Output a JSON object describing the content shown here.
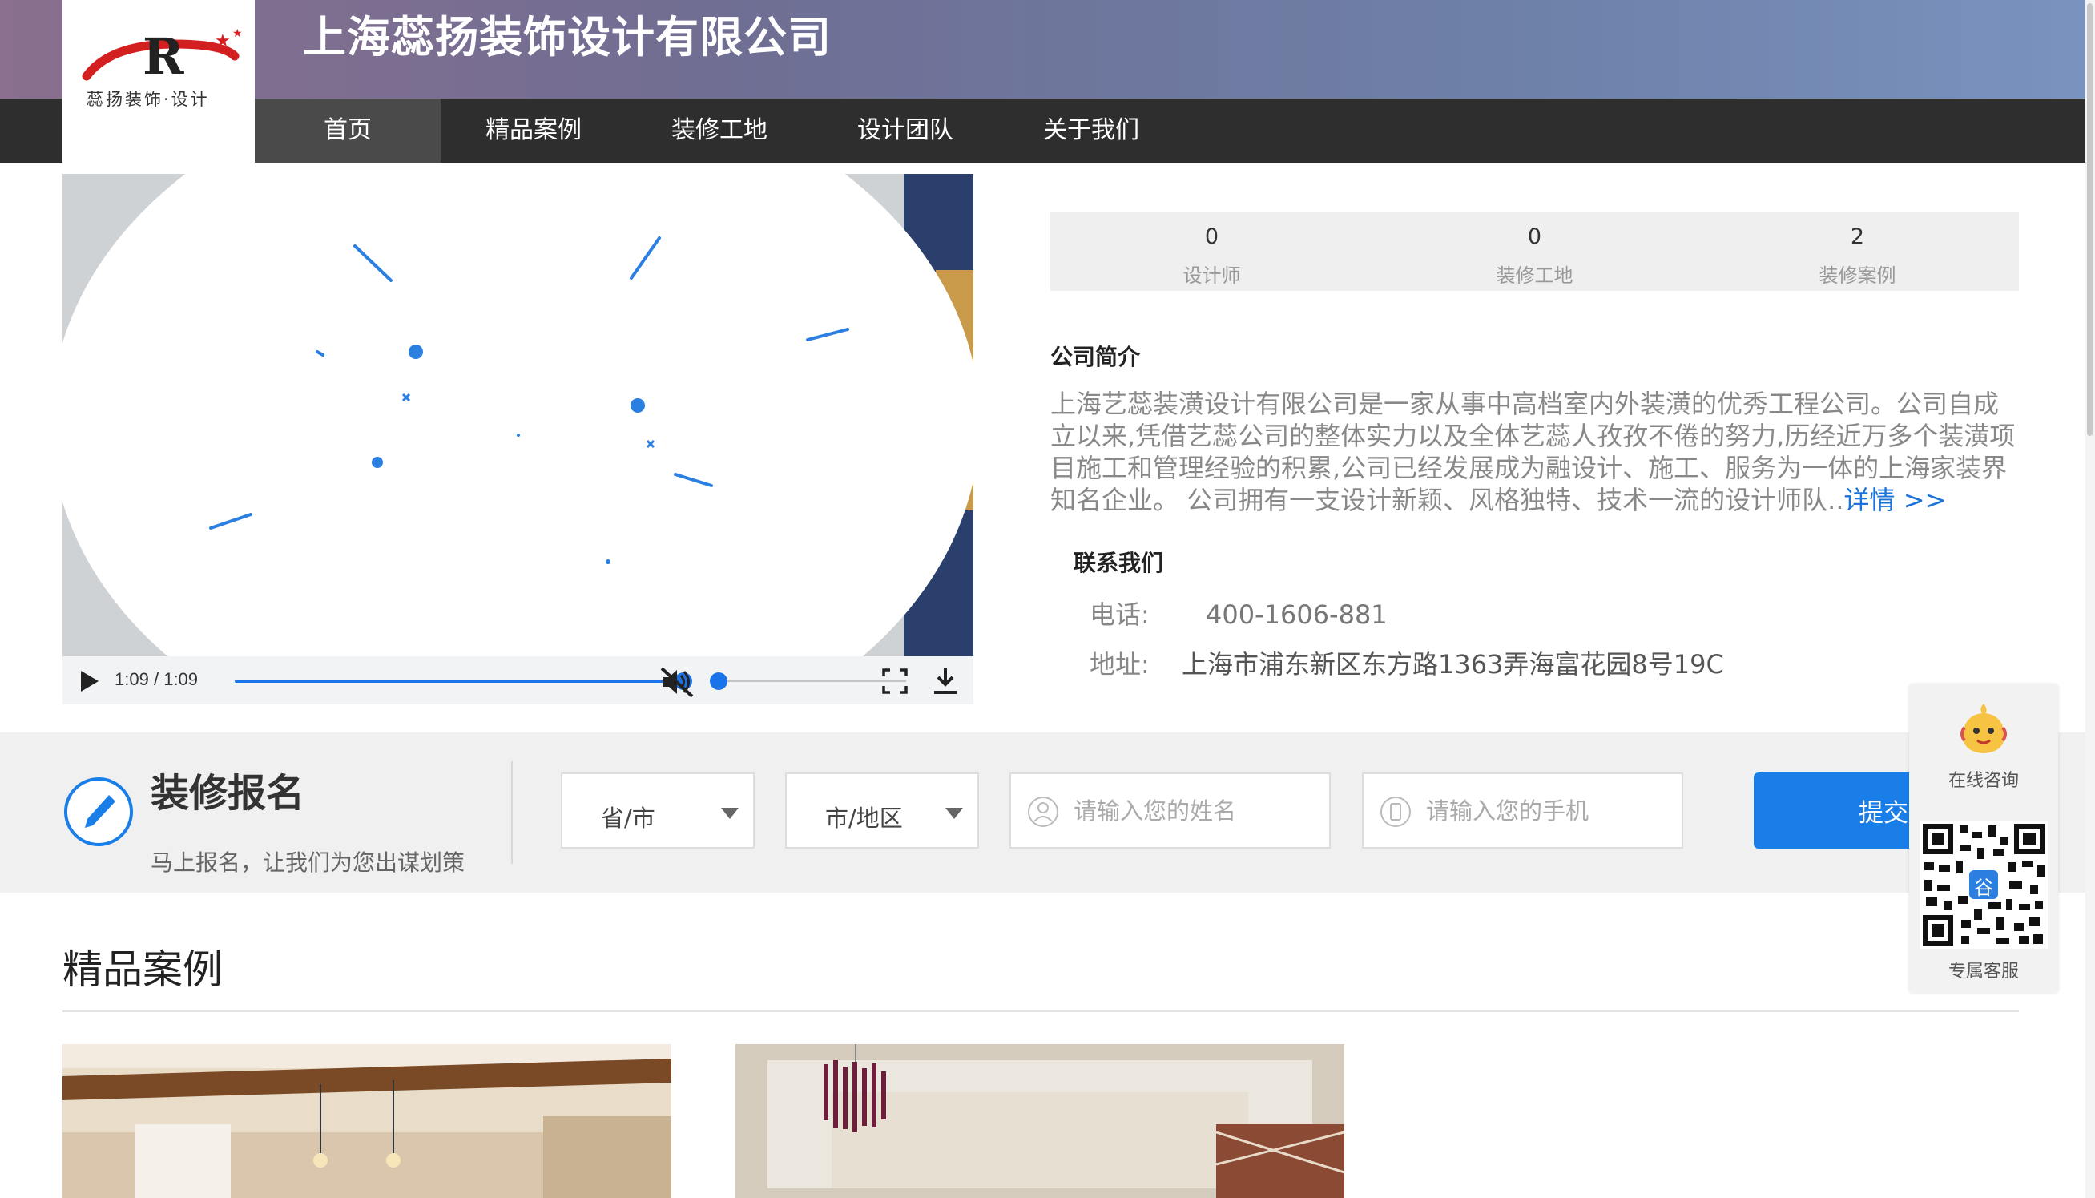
{
  "header": {
    "company_name": "上海蕊扬装饰设计有限公司",
    "logo_text": "蕊扬装饰·设计",
    "nav": [
      {
        "label": "首页",
        "active": true
      },
      {
        "label": "精品案例",
        "active": false
      },
      {
        "label": "装修工地",
        "active": false
      },
      {
        "label": "设计团队",
        "active": false
      },
      {
        "label": "关于我们",
        "active": false
      }
    ]
  },
  "video": {
    "current_time": "1:09",
    "separator": "/",
    "duration": "1:09",
    "progress": 1.0,
    "volume": 0.0
  },
  "stats": [
    {
      "value": "0",
      "label": "设计师"
    },
    {
      "value": "0",
      "label": "装修工地"
    },
    {
      "value": "2",
      "label": "装修案例"
    }
  ],
  "intro": {
    "heading": "公司简介",
    "body": "上海艺蕊装潢设计有限公司是一家从事中高档室内外装潢的优秀工程公司。公司自成立以来,凭借艺蕊公司的整体实力以及全体艺蕊人孜孜不倦的努力,历经近万多个装潢项目施工和管理经验的积累,公司已经发展成为融设计、施工、服务为一体的上海家装界知名企业。 公司拥有一支设计新颖、风格独特、技术一流的设计师队..",
    "more_link": "详情 >>"
  },
  "contact": {
    "heading": "联系我们",
    "phone_label": "电话:",
    "phone": "400-1606-881",
    "address_label": "地址:",
    "address": "上海市浦东新区东方路1363弄海富花园8号19C"
  },
  "signup": {
    "title": "装修报名",
    "subtitle": "马上报名，让我们为您出谋划策",
    "province_select": "省/市",
    "city_select": "市/地区",
    "name_placeholder": "请输入您的姓名",
    "phone_placeholder": "请输入您的手机",
    "submit_label": "提交"
  },
  "cases": {
    "heading": "精品案例"
  },
  "float_service": {
    "online_label": "在线咨询",
    "qr_badge": "谷",
    "service_label": "专属客服"
  },
  "colors": {
    "accent": "#1a7ee8",
    "nav_bg": "#2e2e2e",
    "nav_active": "#4a4a4a"
  }
}
